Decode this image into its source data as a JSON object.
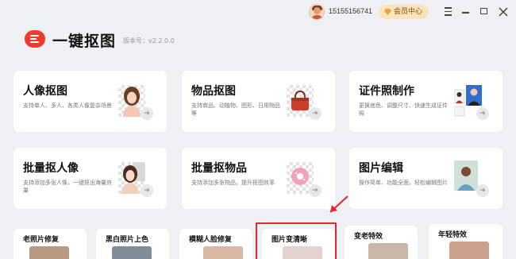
{
  "titlebar": {
    "account_phone": "15155156741",
    "vip_label": "会员中心"
  },
  "app": {
    "name": "一键抠图",
    "version": "版本号：v2.2.0.0"
  },
  "cards_row1": [
    {
      "title": "人像抠图",
      "desc": "支持单人、多人、各类人像复杂场景"
    },
    {
      "title": "物品抠图",
      "desc": "支持商品、动植物、图形、日用物品等"
    },
    {
      "title": "证件照制作",
      "desc": "更换底色、调整尺寸、快速生成证件照"
    }
  ],
  "cards_row2": [
    {
      "title": "批量抠人像",
      "desc": "支持添加多张人像，一键抠出海量效果"
    },
    {
      "title": "批量抠物品",
      "desc": "支持添加多张物品，提升抠图效率"
    },
    {
      "title": "图片编辑",
      "desc": "操作简单、功能全面，轻松编辑图片"
    }
  ],
  "cards_row3": [
    {
      "title": "老照片修复"
    },
    {
      "title": "黑白照片上色"
    },
    {
      "title": "模糊人脸修复"
    },
    {
      "title": "图片变清晰"
    },
    {
      "title": "变老特效"
    },
    {
      "title": "年轻特效"
    }
  ],
  "colors": {
    "brand_red": "#ef3b2d",
    "background": "#eef0f3",
    "vip_bg": "#fde4b8",
    "annotation": "#e0282f"
  },
  "icons": [
    "avatar",
    "diamond-icon",
    "menu-icon",
    "minimize-icon",
    "maximize-icon",
    "close-icon",
    "logo-icon",
    "arrow-badge-icon"
  ]
}
